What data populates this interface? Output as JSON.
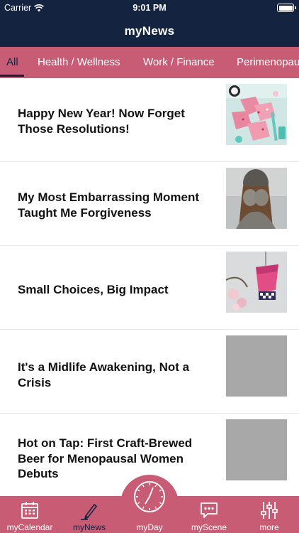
{
  "status_bar": {
    "carrier": "Carrier",
    "time": "9:01 PM"
  },
  "header": {
    "title": "myNews"
  },
  "categories": [
    {
      "label": "All"
    },
    {
      "label": "Health / Wellness"
    },
    {
      "label": "Work / Finance"
    },
    {
      "label": "Perimenopause"
    }
  ],
  "articles": [
    {
      "title": "Happy New Year! Now Forget Those Resolutions!"
    },
    {
      "title": "My Most Embarrassing Moment Taught Me Forgiveness"
    },
    {
      "title": "Small Choices, Big Impact"
    },
    {
      "title": "It's a Midlife Awakening, Not a Crisis"
    },
    {
      "title": "Hot on Tap: First Craft-Brewed Beer for Menopausal Women Debuts"
    }
  ],
  "tabbar": {
    "tabs": [
      {
        "label": "myCalendar",
        "icon": "calendar-icon"
      },
      {
        "label": "myNews",
        "icon": "pen-icon"
      },
      {
        "label": "myDay",
        "icon": "clock-icon"
      },
      {
        "label": "myScene",
        "icon": "chat-icon"
      },
      {
        "label": "more",
        "icon": "sliders-icon"
      }
    ]
  },
  "colors": {
    "navy": "#14233f",
    "rose": "#c75c74"
  }
}
